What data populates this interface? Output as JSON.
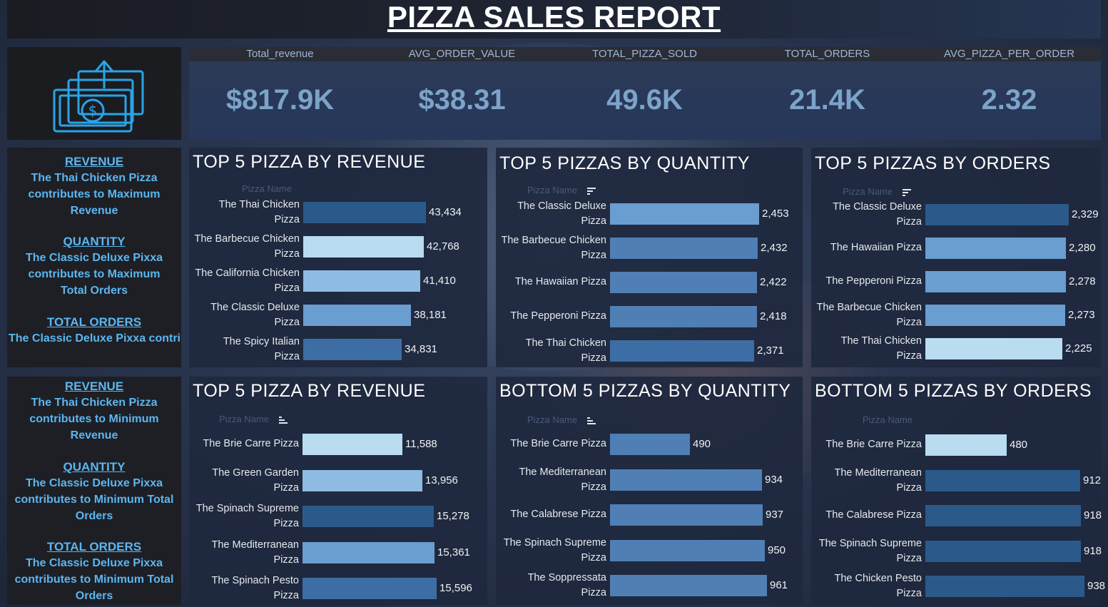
{
  "report_title": "PIZZA SALES REPORT",
  "kpis": [
    {
      "label": "Total_revenue",
      "value": "$817.9K"
    },
    {
      "label": "AVG_ORDER_VALUE",
      "value": "$38.31"
    },
    {
      "label": "TOTAL_PIZZA_SOLD",
      "value": "49.6K"
    },
    {
      "label": "TOTAL_ORDERS",
      "value": "21.4K"
    },
    {
      "label": "AVG_PIZZA_PER_ORDER",
      "value": "2.32"
    }
  ],
  "insights_top": [
    {
      "heading": "REVENUE",
      "text": "The  Thai Chicken Pizza contributes to Maximum Revenue"
    },
    {
      "heading": "QUANTITY",
      "text": "The Classic Deluxe Pixxa contributes to Maximum Total Orders"
    },
    {
      "heading": "TOTAL ORDERS",
      "text": "The Classic Deluxe Pixxa contributes to Maximum Tot.."
    }
  ],
  "insights_bottom": [
    {
      "heading": "REVENUE",
      "text": "The  Thai Chicken Pizza contributes to Minimum Revenue"
    },
    {
      "heading": "QUANTITY",
      "text": "The Classic Deluxe Pixxa contributes to Minimum Total Orders"
    },
    {
      "heading": "TOTAL ORDERS",
      "text": "The Classic Deluxe Pixxa contributes to Minimum Total Orders"
    }
  ],
  "colors": {
    "accent": "#5cb6ef",
    "bar_palette": [
      "#2b5a8a",
      "#3c6ea5",
      "#4f7fb5",
      "#6a9dd0",
      "#8dbbe2",
      "#b9dcf1"
    ]
  },
  "chart_data": [
    {
      "type": "bar",
      "orientation": "horizontal",
      "title": "TOP 5 PIZZA BY REVENUE",
      "field_header": "Pizza Name",
      "categories": [
        "The Thai Chicken Pizza",
        "The Barbecue Chicken Pizza",
        "The California Chicken Pizza",
        "The Classic Deluxe Pizza",
        "The Spicy Italian Pizza"
      ],
      "values": [
        43434,
        42768,
        41410,
        38181,
        34831
      ],
      "value_labels": [
        "43,434",
        "42,768",
        "41,410",
        "38,181",
        "34,831"
      ],
      "bar_colors": [
        "#2b5a8a",
        "#b9dcf1",
        "#8dbbe2",
        "#6a9dd0",
        "#3c6ea5"
      ]
    },
    {
      "type": "bar",
      "orientation": "horizontal",
      "title": "TOP 5 PIZZAS BY QUANTITY",
      "field_header": "Pizza Name",
      "categories": [
        "The Classic Deluxe Pizza",
        "The Barbecue Chicken Pizza",
        "The Hawaiian Pizza",
        "The Pepperoni Pizza",
        "The Thai Chicken Pizza"
      ],
      "values": [
        2453,
        2432,
        2422,
        2418,
        2371
      ],
      "value_labels": [
        "2,453",
        "2,432",
        "2,422",
        "2,418",
        "2,371"
      ],
      "bar_colors": [
        "#6a9dd0",
        "#4f7fb5",
        "#4f7fb5",
        "#4f7fb5",
        "#3c6ea5"
      ]
    },
    {
      "type": "bar",
      "orientation": "horizontal",
      "title": "TOP 5 PIZZAS BY ORDERS",
      "field_header": "Pizza Name",
      "categories": [
        "The Classic Deluxe Pizza",
        "The Hawaiian Pizza",
        "The Pepperoni Pizza",
        "The Barbecue Chicken Pizza",
        "The Thai Chicken Pizza"
      ],
      "values": [
        2329,
        2280,
        2278,
        2273,
        2225
      ],
      "value_labels": [
        "2,329",
        "2,280",
        "2,278",
        "2,273",
        "2,225"
      ],
      "bar_colors": [
        "#2b5a8a",
        "#6a9dd0",
        "#6a9dd0",
        "#6a9dd0",
        "#b9dcf1"
      ]
    },
    {
      "type": "bar",
      "orientation": "horizontal",
      "title": "TOP 5 PIZZA BY REVENUE",
      "field_header": "Pizza Name",
      "categories": [
        "The Brie Carre Pizza",
        "The Green Garden Pizza",
        "The Spinach Supreme Pizza",
        "The Mediterranean Pizza",
        "The Spinach Pesto Pizza"
      ],
      "values": [
        11588,
        13956,
        15278,
        15361,
        15596
      ],
      "value_labels": [
        "11,588",
        "13,956",
        "15,278",
        "15,361",
        "15,596"
      ],
      "bar_colors": [
        "#b9dcf1",
        "#8dbbe2",
        "#2b5a8a",
        "#6a9dd0",
        "#3c6ea5"
      ]
    },
    {
      "type": "bar",
      "orientation": "horizontal",
      "title": "BOTTOM 5 PIZZAS BY QUANTITY",
      "field_header": "Pizza Name",
      "categories": [
        "The Brie Carre Pizza",
        "The Mediterranean Pizza",
        "The Calabrese Pizza",
        "The Spinach Supreme Pizza",
        "The Soppressata Pizza"
      ],
      "values": [
        490,
        934,
        937,
        950,
        961
      ],
      "value_labels": [
        "490",
        "934",
        "937",
        "950",
        "961"
      ],
      "bar_colors": [
        "#4f7fb5",
        "#4f7fb5",
        "#4f7fb5",
        "#4f7fb5",
        "#4f7fb5"
      ]
    },
    {
      "type": "bar",
      "orientation": "horizontal",
      "title": "BOTTOM 5 PIZZAS BY ORDERS",
      "field_header": "Pizza Name",
      "categories": [
        "The Brie Carre Pizza",
        "The Mediterranean Pizza",
        "The Calabrese Pizza",
        "The Spinach Supreme Pizza",
        "The Chicken Pesto Pizza"
      ],
      "values": [
        480,
        912,
        918,
        918,
        938
      ],
      "value_labels": [
        "480",
        "912",
        "918",
        "918",
        "938"
      ],
      "bar_colors": [
        "#b9dcf1",
        "#2b5a8a",
        "#2b5a8a",
        "#2b5a8a",
        "#2b5a8a"
      ]
    }
  ]
}
